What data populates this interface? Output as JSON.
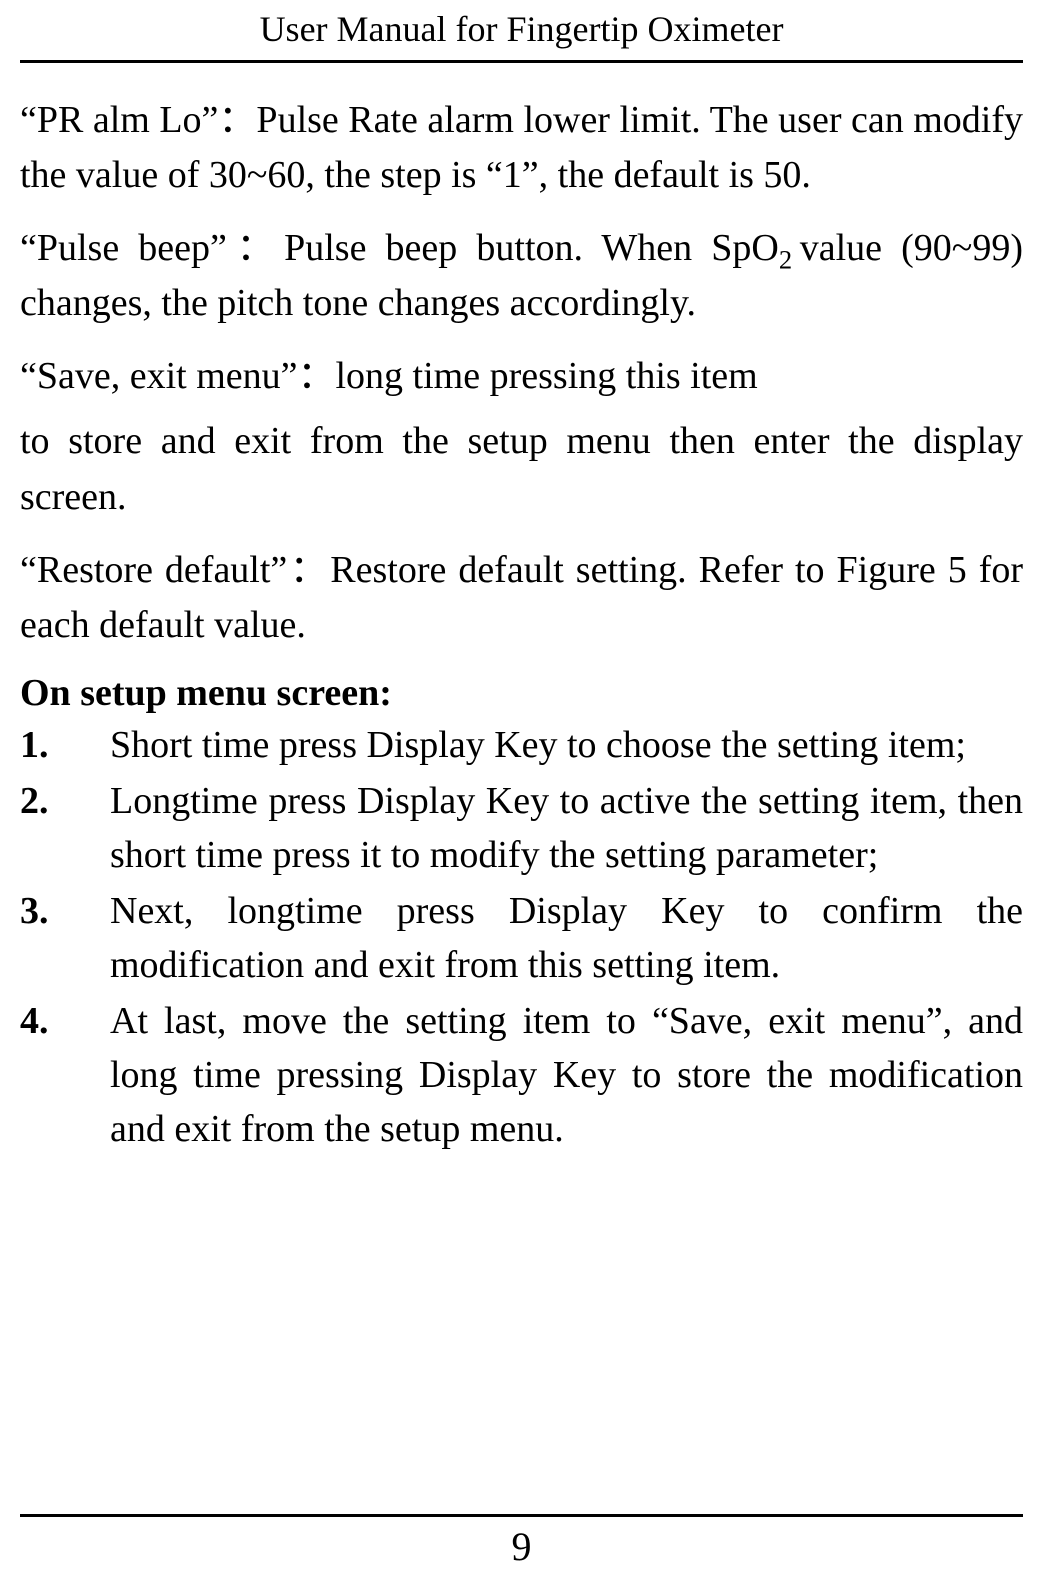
{
  "header": {
    "title": "User Manual for Fingertip Oximeter"
  },
  "paragraphs": {
    "pr_alm_lo": "“PR alm Lo”：Pulse Rate alarm lower limit. The user can modify the value of 30~60, the step is “1”, the default is 50.",
    "pulse_beep_pre": "“Pulse beep”：Pulse beep button. When SpO",
    "pulse_beep_sub": "2",
    "pulse_beep_post": " value (90~99) changes, the pitch tone changes accordingly.",
    "save_exit_1": "“Save, exit menu”：long time pressing this item",
    "save_exit_2": "to store and exit from the setup menu then enter the display screen.",
    "restore_default": "“Restore default”：Restore default setting. Refer to Figure 5 for each default value."
  },
  "section": {
    "heading": "On setup menu screen:",
    "items": [
      {
        "num": "1.",
        "text": "Short time press Display Key to choose the setting item;"
      },
      {
        "num": "2.",
        "text": "Longtime press Display Key to active the setting item, then short time press it to modify the setting parameter;"
      },
      {
        "num": "3.",
        "text": "Next, longtime press Display Key to confirm the modification and exit from this setting item."
      },
      {
        "num": "4.",
        "text": "At last, move the setting item to “Save, exit menu”, and long time pressing Display Key to store the modification and exit from the setup menu."
      }
    ]
  },
  "footer": {
    "page_number": "9"
  }
}
